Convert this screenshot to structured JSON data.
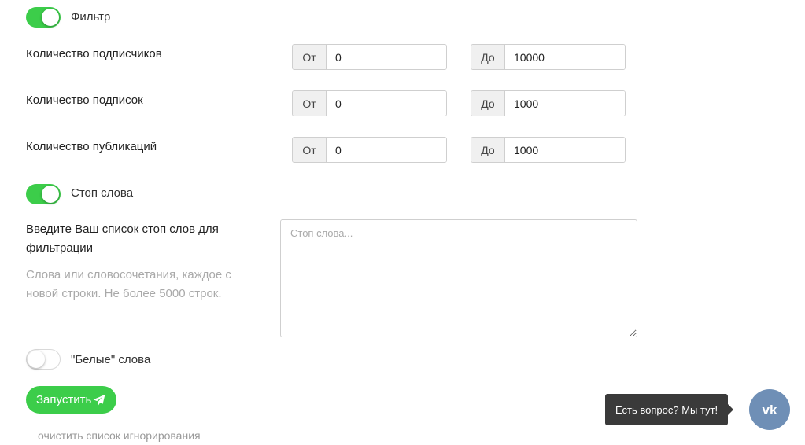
{
  "filter_toggle": {
    "label": "Фильтр",
    "on": true
  },
  "ranges": [
    {
      "label": "Количество подписчиков",
      "from_addon": "От",
      "from_value": "0",
      "to_addon": "До",
      "to_value": "10000"
    },
    {
      "label": "Количество подписок",
      "from_addon": "От",
      "from_value": "0",
      "to_addon": "До",
      "to_value": "1000"
    },
    {
      "label": "Количество публикаций",
      "from_addon": "От",
      "from_value": "0",
      "to_addon": "До",
      "to_value": "1000"
    }
  ],
  "stopwords_toggle": {
    "label": "Стоп слова",
    "on": true
  },
  "stopwords": {
    "title_line1": "Введите Ваш список стоп слов для",
    "title_line2": "фильтрации",
    "hint_line1": "Слова или словосочетания, каждое с",
    "hint_line2": "новой строки. Не более 5000 строк.",
    "placeholder": "Стоп слова..."
  },
  "whitewords_toggle": {
    "label": "\"Белые\" слова",
    "on": false
  },
  "run_button": {
    "label": "Запустить",
    "icon": "paper-plane-icon"
  },
  "clear_link": "очистить список игнорирования",
  "chat": {
    "tooltip": "Есть вопрос? Мы тут!",
    "icon": "vk-icon"
  },
  "colors": {
    "accent": "#3ccd4a",
    "vk": "#6f8fb6",
    "tooltip_bg": "#3a3a3a",
    "hint": "#a9a9a9"
  }
}
